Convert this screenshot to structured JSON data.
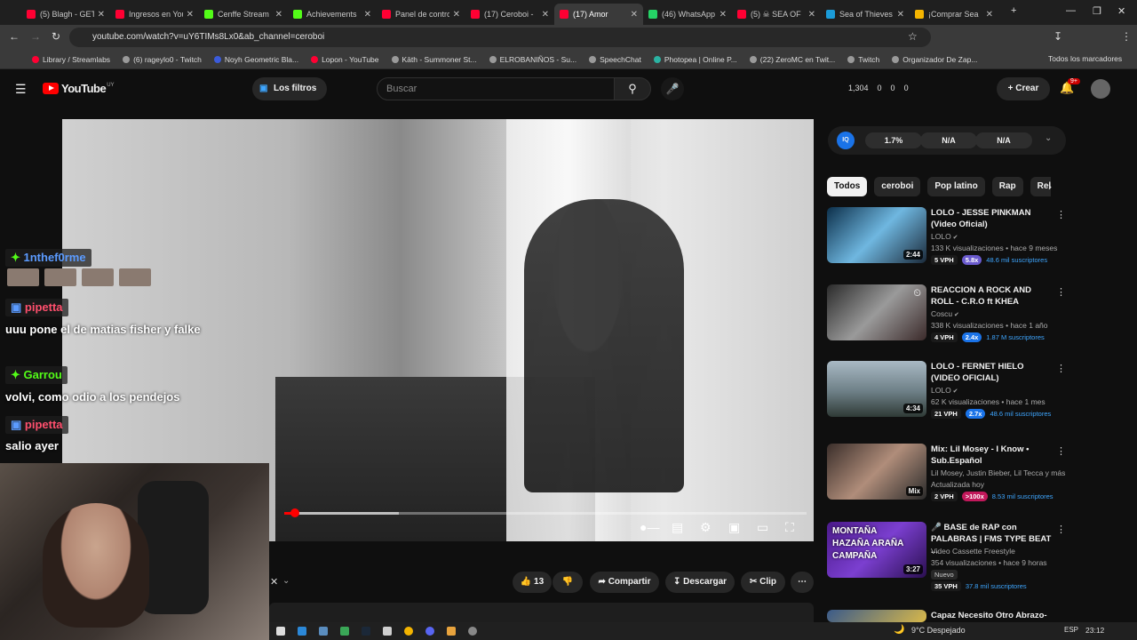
{
  "browser": {
    "tabs": [
      {
        "title": "(5) Blagh - GET",
        "fav": "#ff0033"
      },
      {
        "title": "Ingresos en YouTube",
        "fav": "#ff0033"
      },
      {
        "title": "Cenffe Stream",
        "fav": "#53fc18"
      },
      {
        "title": "Achievements",
        "fav": "#53fc18"
      },
      {
        "title": "Panel de control",
        "fav": "#ff0033"
      },
      {
        "title": "(17) Ceroboi -",
        "fav": "#ff0033"
      },
      {
        "title": "(17) Amor",
        "fav": "#ff0033",
        "active": true
      },
      {
        "title": "(46) WhatsApp",
        "fav": "#25d366"
      },
      {
        "title": "(5) ☠ SEA OF",
        "fav": "#ff0033"
      },
      {
        "title": "Sea of Thieves",
        "fav": "#1b9bd8"
      },
      {
        "title": "¡Comprar Sea",
        "fav": "#f4b400"
      }
    ],
    "url": "youtube.com/watch?v=uY6TIMs8Lx0&ab_channel=ceroboi",
    "bookmarks": [
      "Library / Streamlabs",
      "(6) rageylo0 - Twitch",
      "Noyh Geometric Bla...",
      "Lopon - YouTube",
      "Kāth - Summoner St...",
      "ELROBANIÑOS - Su...",
      "SpeechChat",
      "Photopea | Online P...",
      "(22) ZeroMC en Twit...",
      "Twitch",
      "Organizador De Zap..."
    ],
    "all_bookmarks": "Todos los marcadores"
  },
  "yt": {
    "logo": "YouTube",
    "country": "UY",
    "filters_label": "Los filtros",
    "search_placeholder": "Buscar",
    "stats": [
      "1,304",
      "0",
      "0",
      "0"
    ],
    "create_label": "Crear",
    "notif_badge": "9+"
  },
  "player": {
    "progress_fraction": 0.02,
    "buffer_fraction": 0.22
  },
  "chat": [
    {
      "user": "1nthef0rme",
      "color": "#5b9bff",
      "text": ""
    },
    {
      "user": "pipetta",
      "color": "#ff4f6d",
      "text": "uuu pone el de matias fisher y falke"
    },
    {
      "user": "Garrou",
      "color": "#53fc18",
      "text": "volvi, como odio a los pendejos"
    },
    {
      "user": "pipetta",
      "color": "#ff4f6d",
      "text": "salio ayer"
    }
  ],
  "actions": {
    "likes": "13",
    "share": "Compartir",
    "download": "Descargar",
    "clip": "Clip"
  },
  "iq": {
    "label": "IQ",
    "values": [
      "1.7%",
      "N/A",
      "N/A"
    ]
  },
  "chips": [
    "Todos",
    "ceroboi",
    "Pop latino",
    "Rap",
    "Relac"
  ],
  "recommendations": [
    {
      "title": "LOLO - JESSE PINKMAN (Video Oficial)",
      "channel": "LOLO",
      "meta": "133 K visualizaciones • hace 9 meses",
      "vph": "5 VPH",
      "mult": "5.8x",
      "mult_color": "#6a5acd",
      "subs": "48.6 mil suscriptores",
      "duration": "2:44",
      "thumb": "linear-gradient(135deg,#0c2f4a,#6fb7e0 50%,#1b2a3a)"
    },
    {
      "title": "REACCION A ROCK AND ROLL - C.R.O ft KHEA",
      "channel": "Coscu",
      "meta": "338 K visualizaciones • hace 1 año",
      "vph": "4 VPH",
      "mult": "2.4x",
      "mult_color": "#1a73e8",
      "subs": "1.87 M suscriptores",
      "duration": "",
      "thumb": "linear-gradient(135deg,#2a2a2a,#9a9a9a 50%,#3b2a2a)"
    },
    {
      "title": "LOLO - FERNET HIELO (VIDEO OFICIAL)",
      "channel": "LOLO",
      "meta": "62 K visualizaciones • hace 1 mes",
      "vph": "21 VPH",
      "mult": "2.7x",
      "mult_color": "#1a73e8",
      "subs": "48.6 mil suscriptores",
      "duration": "4:34",
      "thumb": "linear-gradient(180deg,#a9b9c4,#6d7f86 55%,#2f3a36)"
    },
    {
      "title": "Mix: Lil Mosey - I Know • Sub.Español",
      "channel": "Lil Mosey, Justin Bieber, Lil Tecca y más",
      "meta": "Actualizada hoy",
      "vph": "2 VPH",
      "mult": ">100x",
      "mult_color": "#c2185b",
      "subs": "8.53 mil suscriptores",
      "duration": "Mix",
      "thumb": "linear-gradient(135deg,#3a2e2a,#b08d7a 50%,#2a2a2a)"
    },
    {
      "title": "🎤 BASE de RAP con PALABRAS | FMS TYPE BEAT ...",
      "channel": "Video Cassette Freestyle",
      "meta": "354 visualizaciones • hace 9 horas",
      "tag": "Nuevo",
      "vph": "35 VPH",
      "mult": "",
      "mult_color": "",
      "subs": "37.8 mil suscriptores",
      "duration": "3:27",
      "thumb": "linear-gradient(135deg,#4b1a8a,#7b3fd0 50%,#2a0f50)",
      "thumb_text": "MONTAÑA HAZAÑA ARAÑA CAMPAÑA"
    },
    {
      "title": "Capaz Necesito Otro Abrazo-",
      "channel": "",
      "meta": "",
      "vph": "",
      "mult": "",
      "mult_color": "",
      "subs": "",
      "duration": "",
      "thumb": "linear-gradient(135deg,#3a5a8a,#d8b84a)"
    }
  ],
  "taskbar": {
    "weather": "9°C Despejado",
    "lang": "ESP",
    "time": "23:12"
  }
}
